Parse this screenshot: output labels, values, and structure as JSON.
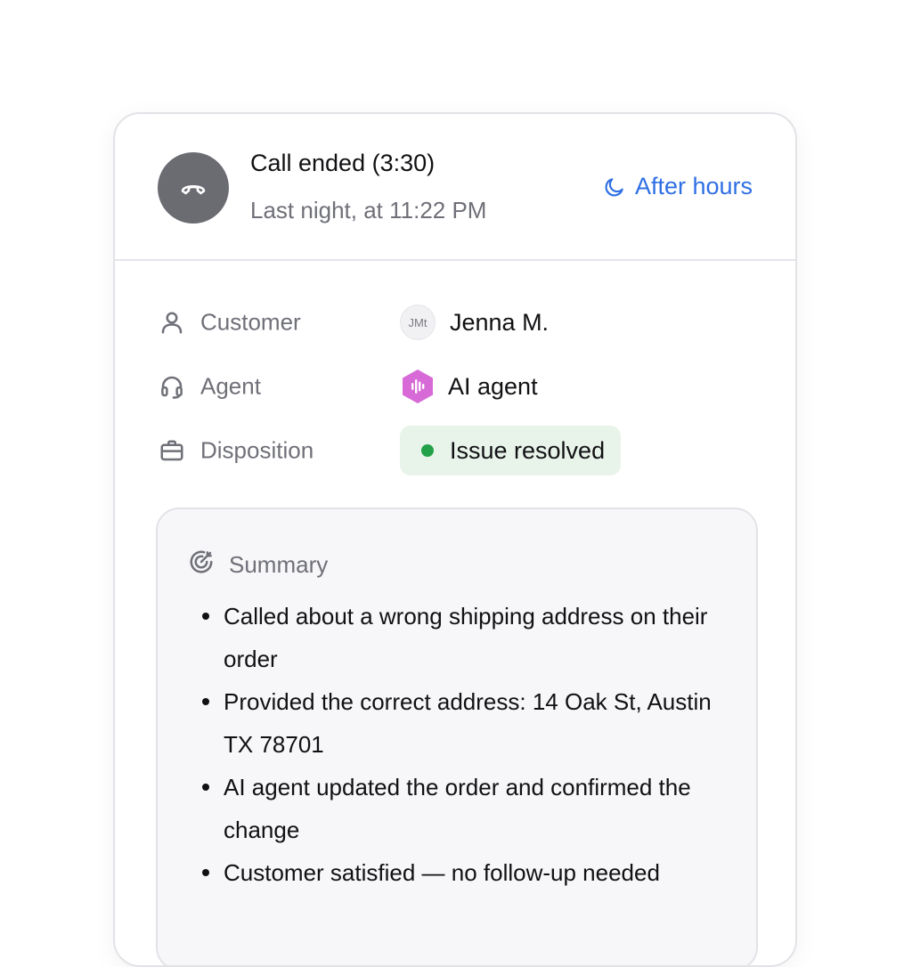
{
  "header": {
    "title": "Call ended (3:30)",
    "subtitle": "Last night, at 11:22 PM",
    "after_hours_label": "After hours",
    "accent_color": "#2f6fe4"
  },
  "details": {
    "customer": {
      "label": "Customer",
      "avatar_initials": "JMt",
      "name": "Jenna M."
    },
    "agent": {
      "label": "Agent",
      "name": "AI agent",
      "icon_color": "#d76ad6"
    },
    "disposition": {
      "label": "Disposition",
      "value": "Issue resolved",
      "status_color": "#22a148"
    }
  },
  "summary": {
    "title": "Summary",
    "items": [
      "Called about a wrong shipping address on their order",
      "Provided the correct address: 14 Oak St, Austin TX 78701",
      "AI agent updated the order and confirmed the change",
      "Customer satisfied — no follow-up needed"
    ]
  },
  "icons": {
    "call": "hangup-phone-icon",
    "after_hours": "moon-icon",
    "customer": "user-icon",
    "agent": "headset-icon",
    "disposition": "briefcase-icon",
    "summary": "target-icon"
  }
}
